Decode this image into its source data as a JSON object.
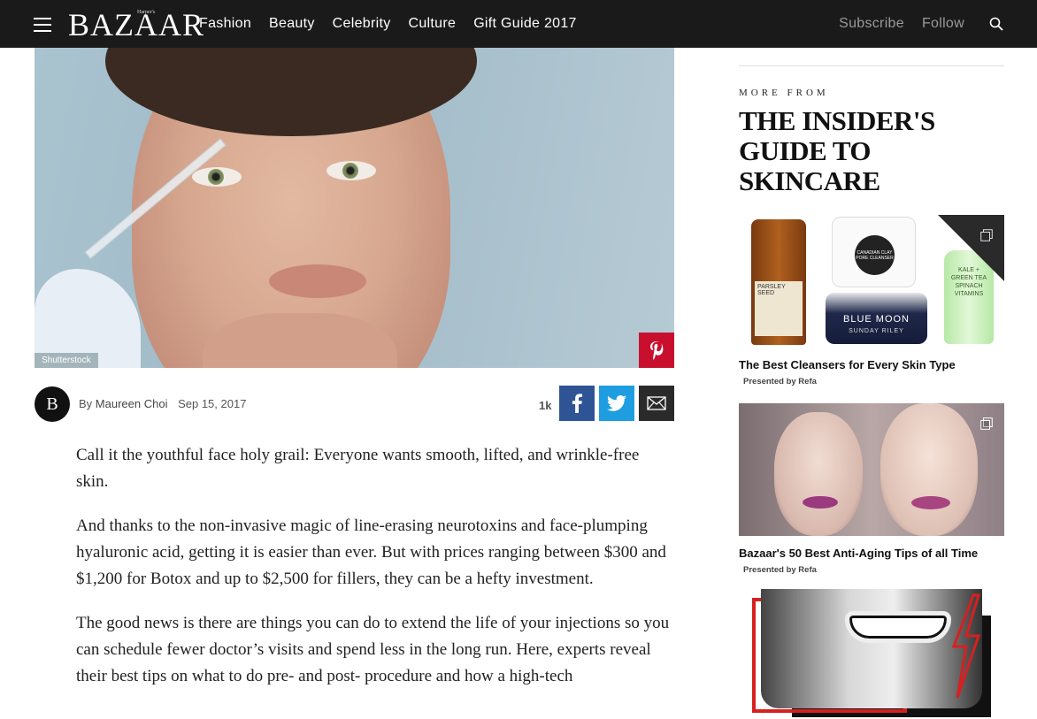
{
  "header": {
    "logo": "BAZAAR",
    "logo_small": "Harper's",
    "nav": [
      "Fashion",
      "Beauty",
      "Celebrity",
      "Culture",
      "Gift Guide 2017"
    ],
    "subscribe": "Subscribe",
    "follow": "Follow"
  },
  "hero": {
    "credit": "Shutterstock"
  },
  "byline": {
    "avatar_letter": "B",
    "prefix": "By",
    "author": "Maureen Choi",
    "date": "Sep 15, 2017",
    "share_count": "1k"
  },
  "article": {
    "paragraphs": [
      "Call it the youthful face holy grail: Everyone wants smooth, lifted, and wrinkle-free skin.",
      "And thanks to the non-invasive magic of line-erasing neurotoxins and face-plumping hyaluronic acid, getting it is easier than ever. But with prices ranging between $300 and $1,200 for Botox and up to $2,500 for fillers, they can be a hefty investment.",
      "The good news is there are things you can do to extend the life of your injections so you can schedule fewer doctor’s visits and spend less in the long run. Here, experts reveal their best tips on what to do pre- and post- procedure and how a high-tech"
    ]
  },
  "sidebar": {
    "more_from": "MORE FROM",
    "title": "THE INSIDER'S GUIDE TO SKINCARE",
    "cards": [
      {
        "title": "The Best Cleansers for Every Skin Type",
        "sub": "Presented by Refa"
      },
      {
        "title": "Bazaar's 50 Best Anti-Aging Tips of all Time",
        "sub": "Presented by Refa"
      }
    ],
    "products": {
      "bottle1": "PARSLEY SEED",
      "jar_top": "CANADIAN CLAY PORE CLEANSER",
      "jar_bottom": "BLUE MOON",
      "jar_bottom_brand": "SUNDAY RILEY",
      "bottle2": "KALE + GREEN TEA SPINACH VITAMINS"
    }
  },
  "colors": {
    "header_bg": "#1a1a1a",
    "pinterest": "#c8102e",
    "facebook": "#2f5496",
    "twitter": "#1e9ee0",
    "email": "#2a2a2a"
  }
}
